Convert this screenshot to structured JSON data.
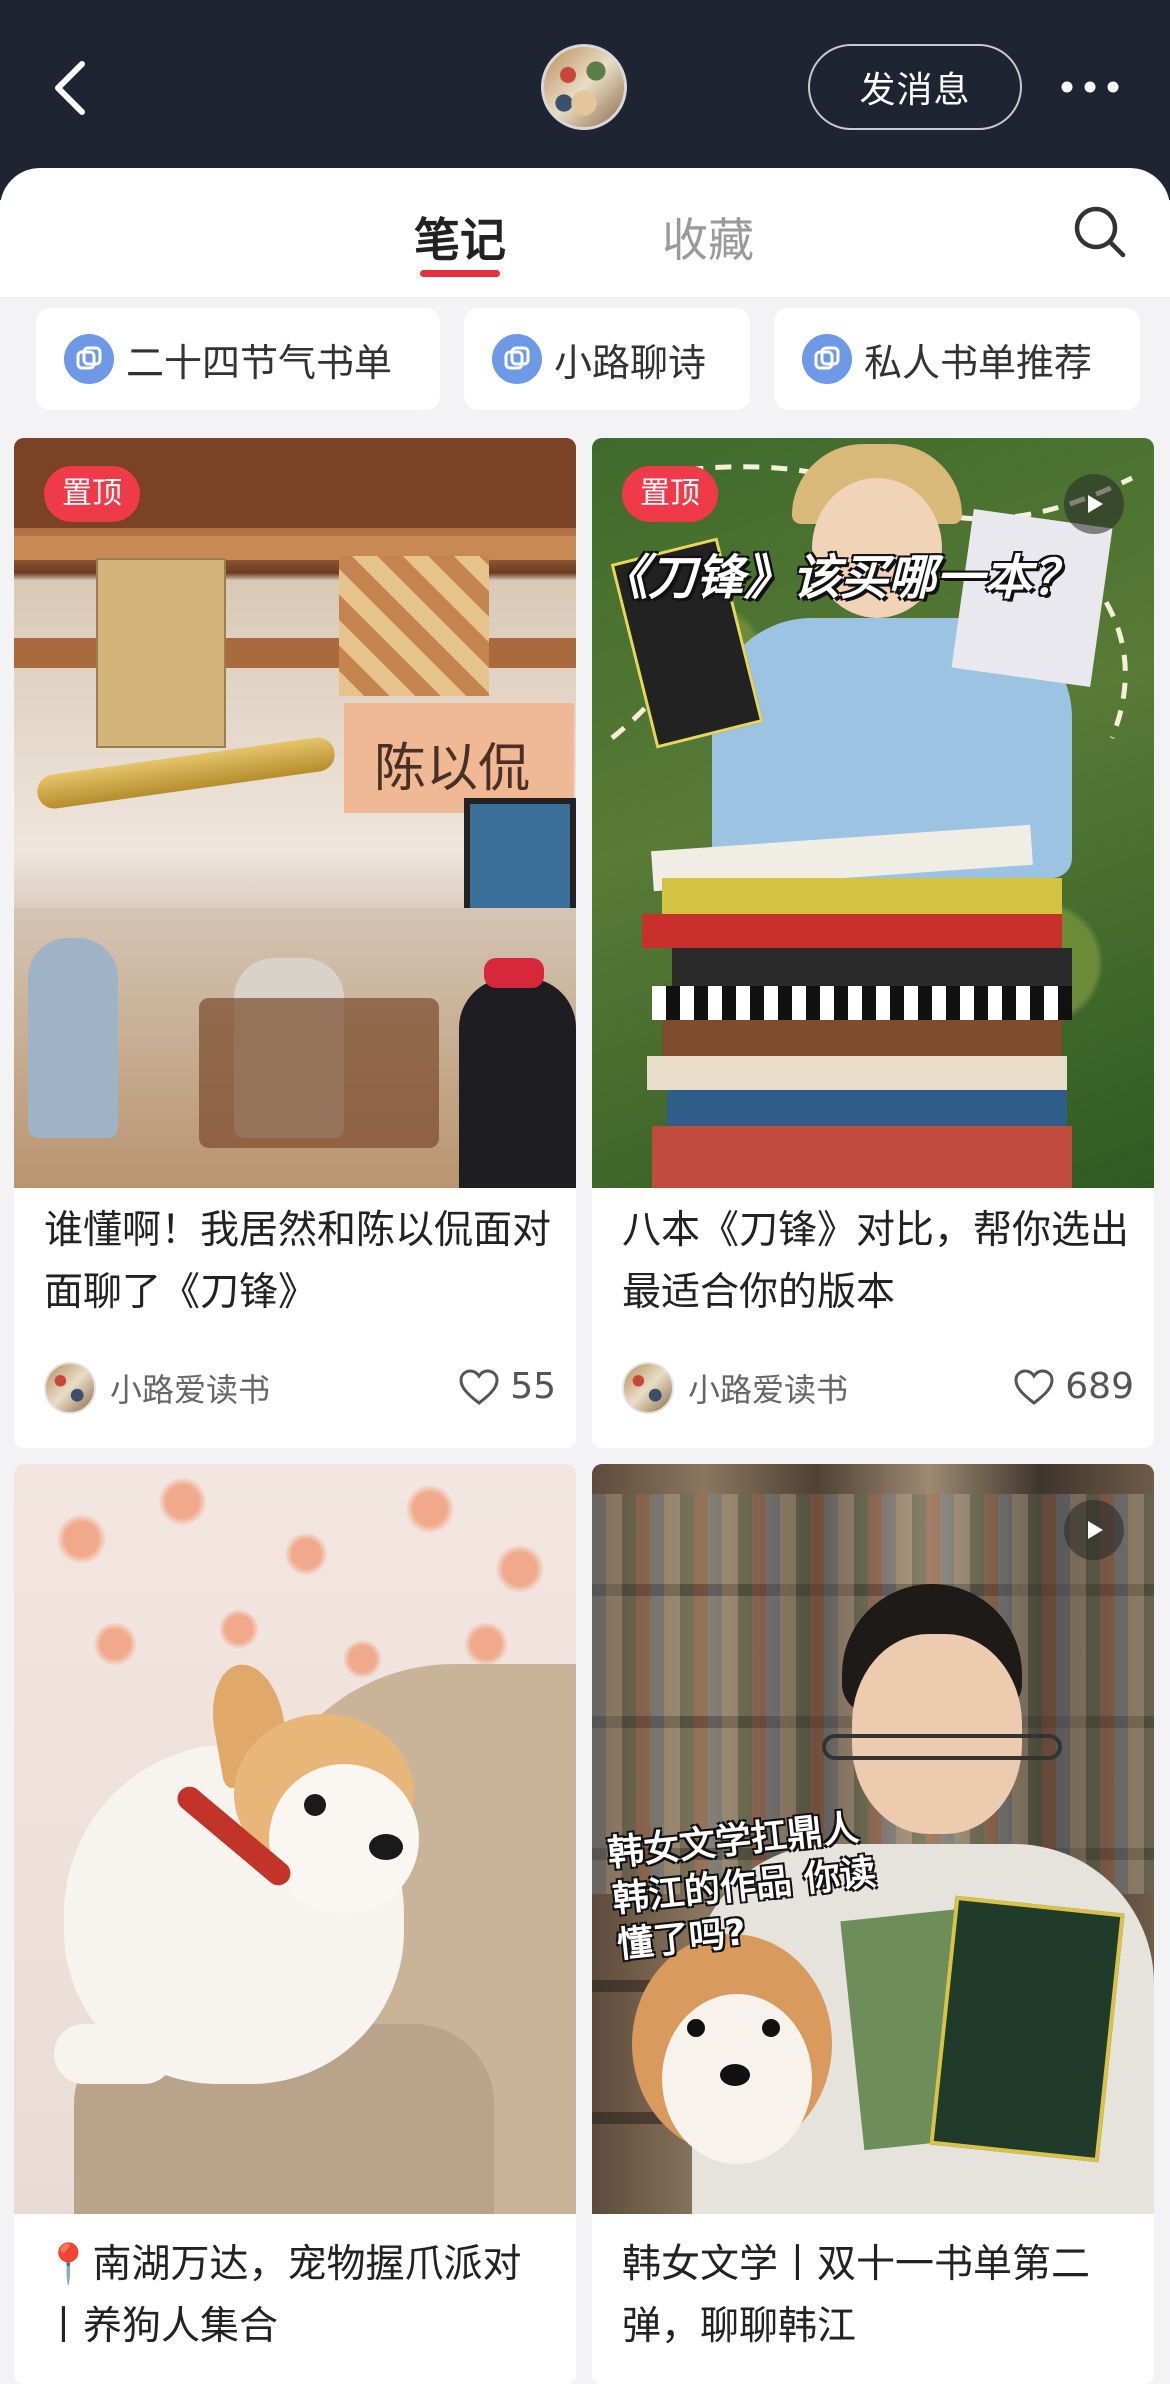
{
  "header": {
    "back_label": "返回",
    "message_button": "发消息",
    "more_label": "更多"
  },
  "tabs": [
    {
      "label": "笔记",
      "active": true
    },
    {
      "label": "收藏",
      "active": false
    }
  ],
  "collections": [
    {
      "label": "二十四节气书单"
    },
    {
      "label": "小路聊诗"
    },
    {
      "label": "私人书单推荐"
    }
  ],
  "cards": [
    {
      "badge": "置顶",
      "cover_caption": "陈以侃",
      "title": "谁懂啊！我居然和陈以侃面对面聊了《刀锋》",
      "author": "小路爱读书",
      "likes": "55",
      "video": false
    },
    {
      "badge": "置顶",
      "cover_caption": "《刀锋》该买哪一本？",
      "title": "八本《刀锋》对比，帮你选出最适合你的版本",
      "author": "小路爱读书",
      "likes": "689",
      "video": true
    },
    {
      "badge": "",
      "title": "📍南湖万达，宠物握爪派对丨养狗人集合",
      "author": "",
      "likes": "",
      "video": false
    },
    {
      "badge": "",
      "cover_caption": "韩女文学扛鼎人 韩江的作品 你读懂了吗?",
      "title": "韩女文学丨双十一书单第二弹，聊聊韩江",
      "author": "",
      "likes": "",
      "video": true
    }
  ],
  "colors": {
    "header_bg": "#1e2432",
    "accent": "#e5303f",
    "badge": "#ef3a4a",
    "chip_icon": "#6e99e6"
  }
}
